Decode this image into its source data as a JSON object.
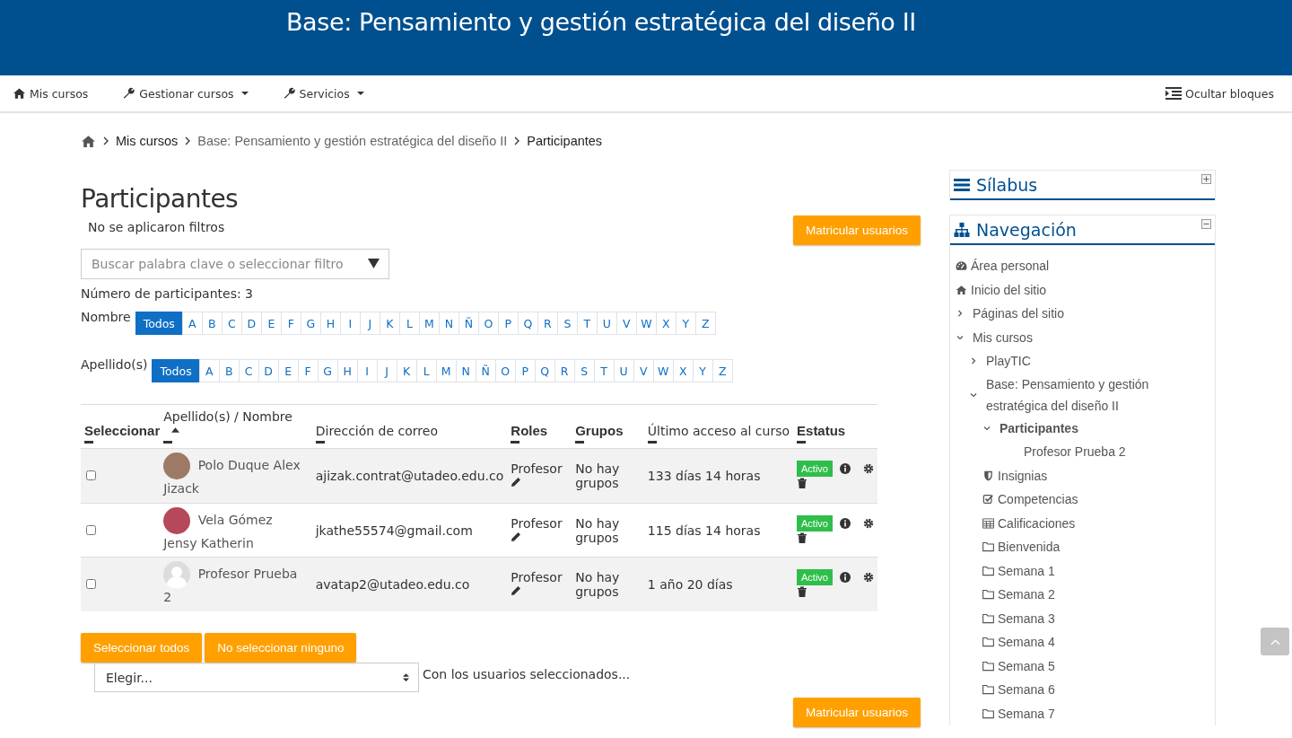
{
  "header": {
    "title": "Base: Pensamiento y gestión estratégica del diseño II"
  },
  "navbar": {
    "items": [
      {
        "label": "Mis cursos",
        "kind": "home",
        "dropdown": false
      },
      {
        "label": "Gestionar cursos",
        "kind": "wrench",
        "dropdown": true
      },
      {
        "label": "Servicios",
        "kind": "wrench",
        "dropdown": true
      }
    ],
    "hide_blocks": "Ocultar bloques"
  },
  "breadcrumb": [
    "Mis cursos",
    "Base: Pensamiento y gestión estratégica del diseño II",
    "Participantes"
  ],
  "page_title": "Participantes",
  "filters_note": "No se aplicaron filtros",
  "enrol_button": "Matricular usuarios",
  "search": {
    "placeholder": "Buscar palabra clave o seleccionar filtro"
  },
  "count": "Número de participantes: 3",
  "initials": [
    {
      "label": "Nombre",
      "letters": [
        {
          "text": "Todos",
          "selected": true
        },
        {
          "text": "A",
          "selected": false
        },
        {
          "text": "B",
          "selected": false
        },
        {
          "text": "C",
          "selected": false
        },
        {
          "text": "D",
          "selected": false
        },
        {
          "text": "E",
          "selected": false
        },
        {
          "text": "F",
          "selected": false
        },
        {
          "text": "G",
          "selected": false
        },
        {
          "text": "H",
          "selected": false
        },
        {
          "text": "I",
          "selected": false
        },
        {
          "text": "J",
          "selected": false
        },
        {
          "text": "K",
          "selected": false
        },
        {
          "text": "L",
          "selected": false
        },
        {
          "text": "M",
          "selected": false
        },
        {
          "text": "N",
          "selected": false
        },
        {
          "text": "Ñ",
          "selected": false
        },
        {
          "text": "O",
          "selected": false
        },
        {
          "text": "P",
          "selected": false
        },
        {
          "text": "Q",
          "selected": false
        },
        {
          "text": "R",
          "selected": false
        },
        {
          "text": "S",
          "selected": false
        },
        {
          "text": "T",
          "selected": false
        },
        {
          "text": "U",
          "selected": false
        },
        {
          "text": "V",
          "selected": false
        },
        {
          "text": "W",
          "selected": false
        },
        {
          "text": "X",
          "selected": false
        },
        {
          "text": "Y",
          "selected": false
        },
        {
          "text": "Z",
          "selected": false
        }
      ]
    },
    {
      "label": "Apellido(s)",
      "letters": [
        {
          "text": "Todos",
          "selected": true
        },
        {
          "text": "A",
          "selected": false
        },
        {
          "text": "B",
          "selected": false
        },
        {
          "text": "C",
          "selected": false
        },
        {
          "text": "D",
          "selected": false
        },
        {
          "text": "E",
          "selected": false
        },
        {
          "text": "F",
          "selected": false
        },
        {
          "text": "G",
          "selected": false
        },
        {
          "text": "H",
          "selected": false
        },
        {
          "text": "I",
          "selected": false
        },
        {
          "text": "J",
          "selected": false
        },
        {
          "text": "K",
          "selected": false
        },
        {
          "text": "L",
          "selected": false
        },
        {
          "text": "M",
          "selected": false
        },
        {
          "text": "N",
          "selected": false
        },
        {
          "text": "Ñ",
          "selected": false
        },
        {
          "text": "O",
          "selected": false
        },
        {
          "text": "P",
          "selected": false
        },
        {
          "text": "Q",
          "selected": false
        },
        {
          "text": "R",
          "selected": false
        },
        {
          "text": "S",
          "selected": false
        },
        {
          "text": "T",
          "selected": false
        },
        {
          "text": "U",
          "selected": false
        },
        {
          "text": "V",
          "selected": false
        },
        {
          "text": "W",
          "selected": false
        },
        {
          "text": "X",
          "selected": false
        },
        {
          "text": "Y",
          "selected": false
        },
        {
          "text": "Z",
          "selected": false
        }
      ]
    }
  ],
  "table": {
    "columns": [
      {
        "label": "Seleccionar",
        "sorted": false
      },
      {
        "label": "Apellido(s) / Nombre",
        "sorted": true
      },
      {
        "label": "Dirección de correo",
        "sorted": false
      },
      {
        "label": "Roles",
        "sorted": false
      },
      {
        "label": "Grupos",
        "sorted": false
      },
      {
        "label": "Último acceso al curso",
        "sorted": false
      },
      {
        "label": "Estatus",
        "sorted": false
      }
    ],
    "rows": [
      {
        "checked": false,
        "has_photo": true,
        "name": "Polo Duque Alex Jizack",
        "email": "ajizak.contrat@utadeo.edu.co",
        "role": "Profesor",
        "groups": "No hay grupos",
        "last_access": "133 días 14 horas",
        "status": "Activo"
      },
      {
        "checked": false,
        "has_photo": true,
        "name": "Vela Gómez Jensy Katherin",
        "email": "jkathe55574@gmail.com",
        "role": "Profesor",
        "groups": "No hay grupos",
        "last_access": "115 días 14 horas",
        "status": "Activo"
      },
      {
        "checked": false,
        "has_photo": false,
        "name": "Profesor Prueba 2",
        "email": "avatap2@utadeo.edu.co",
        "role": "Profesor",
        "groups": "No hay grupos",
        "last_access": "1 año 20 días",
        "status": "Activo"
      }
    ]
  },
  "select_all": "Seleccionar todos",
  "select_none": "No seleccionar ninguno",
  "bulk": {
    "value": "Elegir...",
    "label": "Con los usuarios seleccionados..."
  },
  "enrol_button_bottom": "Matricular usuarios",
  "blocks": [
    {
      "title": "Sílabus",
      "kind": "bars",
      "expanded": false
    },
    {
      "title": "Navegación",
      "kind": "sitemap",
      "expanded": true
    }
  ],
  "navigation": [
    {
      "label": "Área personal",
      "kind": "dashboard",
      "active": false
    },
    {
      "label": "Inicio del sitio",
      "kind": "home",
      "active": false
    },
    {
      "label": "Páginas del sitio",
      "kind": "branch",
      "expanded": false,
      "active": false
    },
    {
      "label": "Mis cursos",
      "kind": "branch",
      "expanded": true,
      "active": false,
      "children": [
        {
          "label": "PlayTIC",
          "kind": "branch",
          "expanded": false,
          "active": false
        },
        {
          "label": "Base: Pensamiento y gestión estratégica del diseño II",
          "kind": "branch",
          "expanded": true,
          "active": false,
          "children": [
            {
              "label": "Participantes",
              "kind": "branch",
              "expanded": true,
              "active": true,
              "children": [
                {
                  "label": "Profesor Prueba 2",
                  "kind": "plain",
                  "active": false
                }
              ]
            },
            {
              "label": "Insignias",
              "kind": "shield",
              "active": false
            },
            {
              "label": "Competencias",
              "kind": "check",
              "active": false
            },
            {
              "label": "Calificaciones",
              "kind": "grid",
              "active": false
            },
            {
              "label": "Bienvenida",
              "kind": "folder",
              "active": false
            },
            {
              "label": "Semana 1",
              "kind": "folder",
              "active": false
            },
            {
              "label": "Semana 2",
              "kind": "folder",
              "active": false
            },
            {
              "label": "Semana 3",
              "kind": "folder",
              "active": false
            },
            {
              "label": "Semana 4",
              "kind": "folder",
              "active": false
            },
            {
              "label": "Semana 5",
              "kind": "folder",
              "active": false
            },
            {
              "label": "Semana 6",
              "kind": "folder",
              "active": false
            },
            {
              "label": "Semana 7",
              "kind": "folder",
              "active": false
            }
          ]
        }
      ]
    }
  ]
}
